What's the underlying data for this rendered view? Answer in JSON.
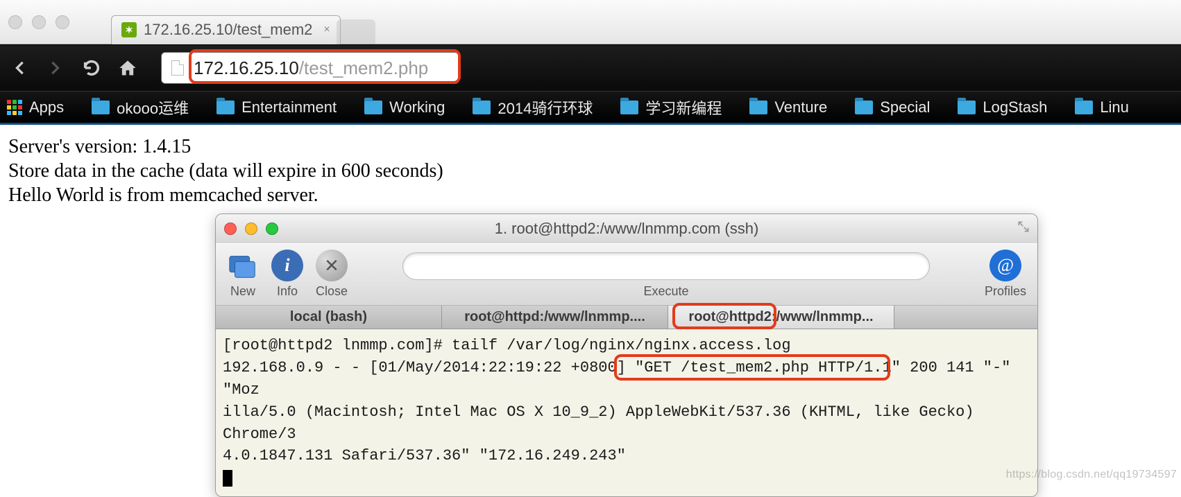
{
  "mac": {
    "tab_title": "172.16.25.10/test_mem2",
    "tab_close_glyph": "×"
  },
  "nav": {
    "url_host": "172.16.25.10",
    "url_path": "/test_mem2.php"
  },
  "bookmarks": {
    "apps_label": "Apps",
    "items": [
      "okooo运维",
      "Entertainment",
      "Working",
      "2014骑行环球",
      "学习新编程",
      "Venture",
      "Special",
      "LogStash",
      "Linu"
    ]
  },
  "page": {
    "line1": "Server's version: 1.4.15",
    "line2": "Store data in the cache (data will expire in 600 seconds)",
    "line3": "Hello World is from memcached server."
  },
  "terminal": {
    "title": "1. root@httpd2:/www/lnmmp.com (ssh)",
    "tools": {
      "new": "New",
      "info": "Info",
      "close": "Close",
      "execute": "Execute",
      "profiles": "Profiles"
    },
    "info_glyph": "i",
    "close_glyph": "✕",
    "profiles_glyph": "@",
    "tabs": {
      "t1": "local (bash)",
      "t2": "root@httpd:/www/lnmmp....",
      "t3_a": "root@httpd2:",
      "t3_b": "/www/lnmmp..."
    },
    "log": {
      "l1": "[root@httpd2 lnmmp.com]# tailf /var/log/nginx/nginx.access.log",
      "l2a": "192.168.0.9 - - [01/May/2014:22:19:22 +0800] ",
      "l2b": "\"GET /test_mem2.php HTTP/1.1\"",
      "l2c": " 200 141 \"-\" \"Moz",
      "l3": "illa/5.0 (Macintosh; Intel Mac OS X 10_9_2) AppleWebKit/537.36 (KHTML, like Gecko) Chrome/3",
      "l4": "4.0.1847.131 Safari/537.36\" \"172.16.249.243\""
    }
  },
  "watermark": "https://blog.csdn.net/qq19734597"
}
